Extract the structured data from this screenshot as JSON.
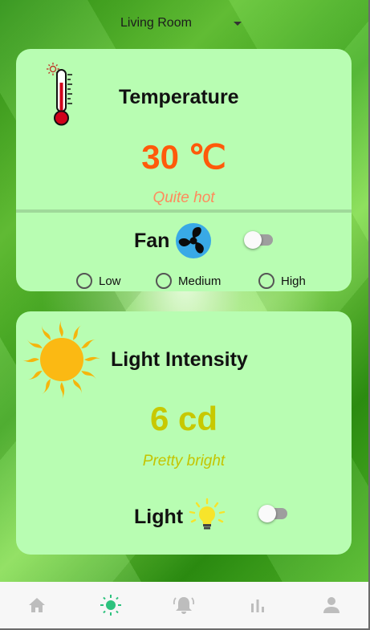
{
  "room_selector": {
    "value": "Living Room"
  },
  "temperature_card": {
    "title": "Temperature",
    "value": "30 ℃",
    "status": "Quite hot",
    "value_color": "#ff5a0a",
    "status_color": "#ff8a5c",
    "device": {
      "label": "Fan",
      "icon": "fan-icon",
      "toggle_on": false,
      "speed_options": [
        "Low",
        "Medium",
        "High"
      ],
      "selected_speed": null
    }
  },
  "light_card": {
    "title": "Light Intensity",
    "value": "6 cd",
    "status": "Pretty bright",
    "value_color": "#c8c800",
    "status_color": "#c4c400",
    "device": {
      "label": "Light",
      "icon": "light-bulb-icon",
      "toggle_on": false
    }
  },
  "bottom_nav": {
    "items": [
      {
        "icon": "home-icon",
        "active": false
      },
      {
        "icon": "sun-icon",
        "active": true
      },
      {
        "icon": "alarm-bell-icon",
        "active": false
      },
      {
        "icon": "bar-chart-icon",
        "active": false
      },
      {
        "icon": "person-icon",
        "active": false
      }
    ],
    "active_color": "#2ec27e",
    "inactive_color": "#bdbdbd"
  }
}
